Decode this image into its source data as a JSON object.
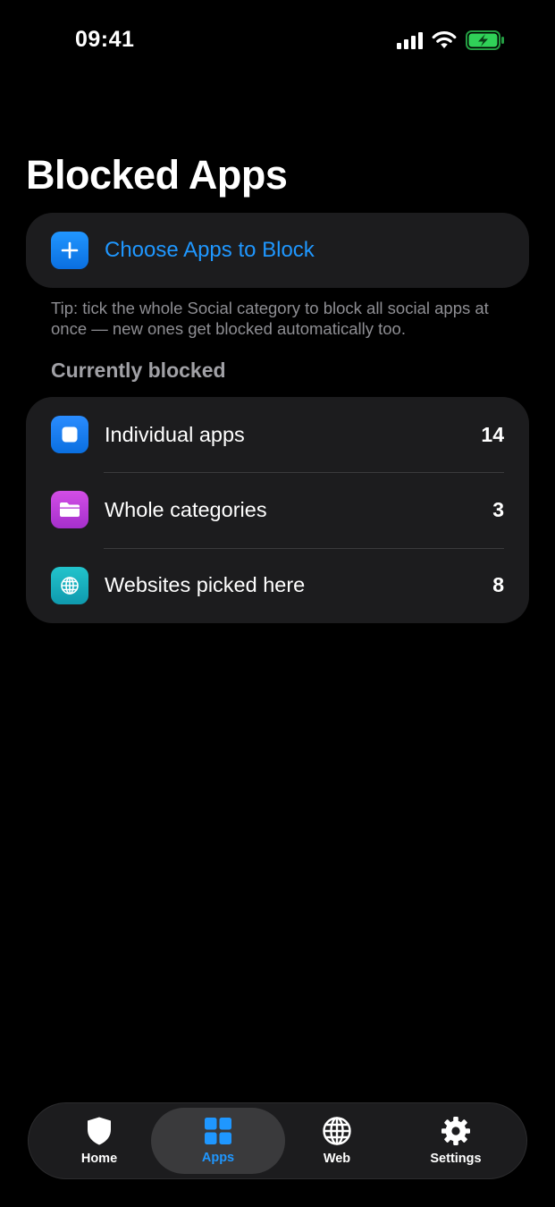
{
  "status_bar": {
    "time": "09:41",
    "icons": [
      "cellular-signal-icon",
      "wifi-icon",
      "battery-charging-icon"
    ]
  },
  "page": {
    "title": "Blocked Apps"
  },
  "choose_apps": {
    "label": "Choose Apps to Block",
    "icon": "plus-icon"
  },
  "tip": "Tip: tick the whole Social category to block all social apps at once — new ones get blocked automatically too.",
  "section": {
    "header": "Currently blocked"
  },
  "blocked_list": {
    "items": [
      {
        "label": "Individual apps",
        "count": "14",
        "icon": "app-square-icon",
        "color": "#0a84ff"
      },
      {
        "label": "Whole categories",
        "count": "3",
        "icon": "folder-icon",
        "color": "#bf3fdc"
      },
      {
        "label": "Websites picked here",
        "count": "8",
        "icon": "globe-icon",
        "color": "#19b3c0"
      }
    ]
  },
  "tab_bar": {
    "tabs": [
      {
        "label": "Home",
        "icon": "shield-icon"
      },
      {
        "label": "Apps",
        "icon": "grid-icon",
        "active": true
      },
      {
        "label": "Web",
        "icon": "globe-icon"
      },
      {
        "label": "Settings",
        "icon": "gear-icon"
      }
    ]
  },
  "colors": {
    "accent": "#1f97ff",
    "background": "#000000",
    "card": "#1c1c1e",
    "battery": "#30d158"
  }
}
